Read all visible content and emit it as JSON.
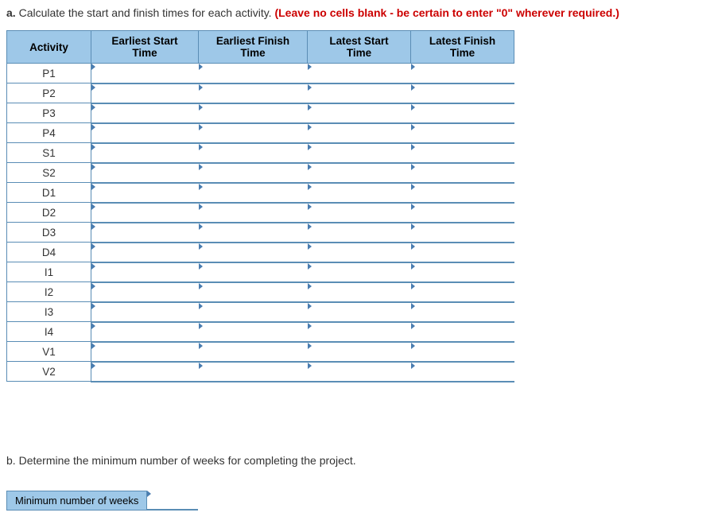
{
  "partA": {
    "label": "a.",
    "text": "Calculate the start and finish times for each activity.",
    "warning": "(Leave no cells blank - be certain to enter \"0\" wherever required.)"
  },
  "table": {
    "headers": {
      "activity": "Activity",
      "est": "Earliest Start Time",
      "eft": "Earliest Finish Time",
      "lst": "Latest Start Time",
      "lft": "Latest Finish Time"
    },
    "rows": [
      {
        "activity": "P1"
      },
      {
        "activity": "P2"
      },
      {
        "activity": "P3"
      },
      {
        "activity": "P4"
      },
      {
        "activity": "S1"
      },
      {
        "activity": "S2"
      },
      {
        "activity": "D1"
      },
      {
        "activity": "D2"
      },
      {
        "activity": "D3"
      },
      {
        "activity": "D4"
      },
      {
        "activity": "I1"
      },
      {
        "activity": "I2"
      },
      {
        "activity": "I3"
      },
      {
        "activity": "I4"
      },
      {
        "activity": "V1"
      },
      {
        "activity": "V2"
      }
    ]
  },
  "partB": {
    "label": "b.",
    "text": "Determine the minimum number of weeks for completing the project.",
    "answerLabel": "Minimum number of weeks"
  }
}
